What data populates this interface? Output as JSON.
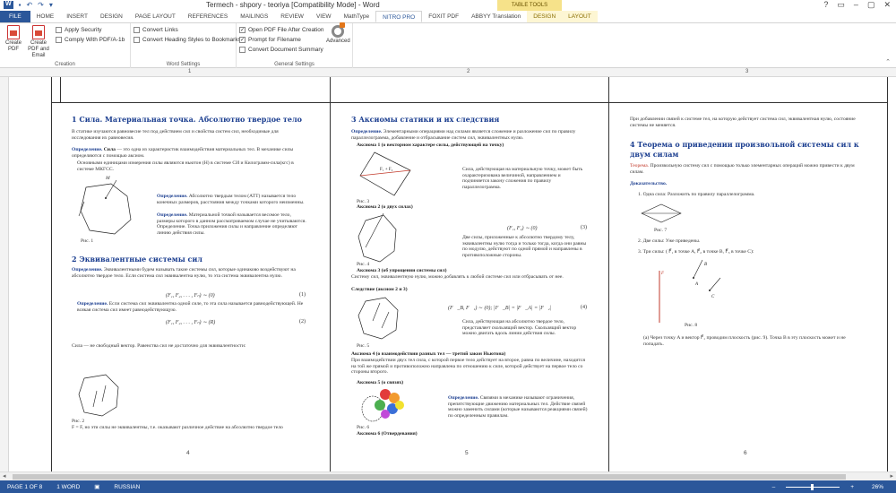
{
  "titlebar": {
    "title": "Termech - shpory - teoriya [Compatibility Mode] - Word",
    "table_tools": "TABLE TOOLS",
    "qat": [
      "save-icon",
      "undo-icon",
      "redo-icon",
      "customize-icon"
    ],
    "window_buttons": [
      "?",
      "▭",
      "–",
      "▢",
      "✕"
    ]
  },
  "tabs": {
    "file": "FILE",
    "items": [
      "HOME",
      "INSERT",
      "DESIGN",
      "PAGE LAYOUT",
      "REFERENCES",
      "MAILINGS",
      "REVIEW",
      "VIEW",
      "MathType",
      "NITRO PRO",
      "FOXIT PDF",
      "ABBYY Translation",
      "DESIGN",
      "LAYOUT"
    ],
    "active": "NITRO PRO"
  },
  "ribbon": {
    "creation": {
      "label": "Creation",
      "create_pdf": "Create PDF",
      "create_pdf_email": "Create PDF and Email",
      "apply_security": "Apply Security",
      "comply": "Comply With PDF/A-1b"
    },
    "word_settings": {
      "label": "Word Settings",
      "convert_links": "Convert Links",
      "convert_headings": "Convert Heading Styles to Bookmarks"
    },
    "general_settings": {
      "label": "General Settings",
      "open_pdf": "Open PDF File After Creation",
      "prompt_filename": "Prompt for Filename",
      "convert_summary": "Convert Document Summary",
      "open_pdf_checked": true,
      "prompt_filename_checked": true,
      "convert_summary_checked": false
    },
    "advanced": "Advanced"
  },
  "ruler": {
    "numbers": [
      "1",
      "2",
      "3"
    ]
  },
  "page1": {
    "sec1": "1   Сила. Материальная точка. Абсолютно твердое тело",
    "p1": "В статике изучаются равновесие тел под действием сил и свойства систем сил, необходимые для исследования их равновесия.",
    "p2_def": "Определение.",
    "p2_b": "Сила",
    "p2": "— это одна из характеристик взаимодействия материальных тел. В механике силы определяются с помощью аксиом.",
    "p3": "Основными единицами измерения силы являются ньютон (Н) в системе СИ и Килограмм-сила(кгс) в системе МКГСС.",
    "fig1_label": "M",
    "fig1_caption": "Рис. 1",
    "def_att_def": "Определение.",
    "def_att": "Абсолютно твердым телом (АТТ) называется тело конечных размеров, расстояния между точками которого неизменны.",
    "def_mp_def": "Определение.",
    "def_mp": "Материальной точкой называется весомое тело, размеры которого в данном рассматриваемом случае не учитываются. Определение. Точка приложения силы и направление определяют линию действия силы.",
    "sec2": "2   Эквивалентные системы сил",
    "p4_def": "Определение.",
    "p4": "Эквивалентными будем называть такие системы сил, которые одинаково воздействуют на абсолютно твердое тело. Если система сил эквивалентна нулю, то эта система эквивалентна нулю.",
    "eq1": "(F₁, F₂, . . . , Fₙ) ∼ (0)",
    "eq1_num": "(1)",
    "p5_def": "Определение.",
    "p5": "Если система сил эквивалентна одной силе, то эта сила называется равнодействующей. Не всякая система сил имеет равнодействующую.",
    "eq2": "(F₁, F₂, . . . , Fₙ) ∼ (R)",
    "eq2_num": "(2)",
    "p6": "Сила — не свободный вектор. Равенства сил не достаточно для эквивалентности:",
    "fig2_caption": "Рис. 2",
    "p7": "F = F, но эти силы не эквивалентны, т.е. оказывают различное действие на абсолютно твердое тело",
    "page_num": "4"
  },
  "page2": {
    "sec3": "3   Аксиомы статики и их следствия",
    "p1_def": "Определение.",
    "p1": "Элементарными операциями над силами является сложение и разложение сил по правилу параллелограмма, добавление и отбрасывание систем сил, эквивалентных нулю.",
    "ax1": "Аксиома 1 (о векторном характере силы, действующей на точку)",
    "ax1_text": "Сила, действующая на материальную точку, может быть охарактеризована величиной, направлением и подчиняется закону сложения по правилу параллелограмма.",
    "fig3_caption": "Рис. 3",
    "ax2": "Аксиома 2 (о двух силах)",
    "eq3": "(F₁, F₂) ∼ (0)",
    "eq3_num": "(3)",
    "ax2_text": "Две силы, приложенные к абсолютно твердому телу, эквивалентны нулю тогда и только тогда, когда они равны по модулю, действуют по одной прямой и направлены в противоположные стороны.",
    "fig4_caption": "Рис. 4",
    "ax3": "Аксиома 3 (об упрощении системы сил)",
    "ax3_text": "Систему сил, эквивалентную нулю, можно добавлять к любой системе сил или отбрасывать от нее.",
    "corollary": "Следствие (аксиом 2 и 3)",
    "eq4": "(F⃗_B, F⃗₁) ∼ (0);   |F⃗_B| = |F⃗_A| = |F⃗₂|",
    "eq4_num": "(4)",
    "cor_text": "Сила, действующая на абсолютно твердое тело, представляет скользящий вектор. Скользящий вектор можно двигать вдоль линии действия силы.",
    "fig5_caption": "Рис. 5",
    "ax4": "Аксиома 4 (о взаимодействии разных тел — третий закон Ньютона)",
    "ax4_text": "При взаимодействии двух тел сила, с которой первое тело действует на второе, равна по величине, находится на той же прямой и противоположно направлена по отношению к силе, которой действует на первое тело со стороны второго.",
    "ax5": "Аксиома 5 (о связях)",
    "ax5_def": "Определение.",
    "ax5_text": "Связями в механике называют ограничения, препятствующие движению материальных тел. Действие связей можно заменить силами (которые называются реакциями связей) по определенным правилам.",
    "fig6_caption": "Рис. 6",
    "ax6": "Аксиома 6 (Отвердевания)",
    "page_num": "5"
  },
  "page3": {
    "p1": "При добавлении связей к системе тел, на которую действует система сил, эквивалентная нулю, состояние системы не меняется.",
    "sec4": "4   Теорема о приведении произвольной системы сил к двум силам",
    "theorem_label": "Теорема.",
    "theorem": "Произвольную систему сил с помощью только элементарных операций можно привести к двум силам.",
    "proof": "Доказательство.",
    "item1": "1.  Одна сила: Разложить по правилу параллелограмма.",
    "fig7_caption": "Рис. 7",
    "item2": "2.  Две силы: Уже приведены.",
    "item3": "3.  Три силы: ( F⃗₁ в точке A, F⃗₂ в точке B, F⃗₃ в точке C):",
    "fig8_caption": "Рис. 8",
    "item3a": "(a)  Через точку A и вектор F⃗₁ проводим плоскость (рис. 9). Точка B в эту плоскость может и не попадать.",
    "fig8_labels": [
      "F",
      "A",
      "B",
      "C"
    ],
    "page_num": "6"
  },
  "statusbar": {
    "page": "PAGE 1 OF 8",
    "words": "1 WORD",
    "language": "RUSSIAN",
    "zoom": "26%"
  }
}
